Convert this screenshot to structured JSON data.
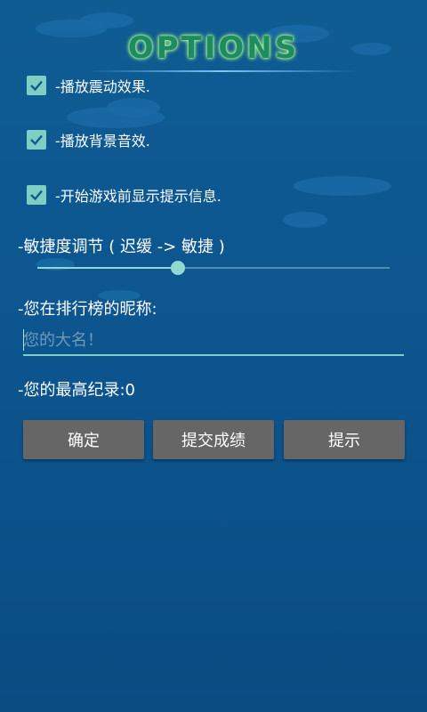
{
  "header": {
    "title": "OPTIONS"
  },
  "checkboxes": [
    {
      "label": "-播放震动效果.",
      "checked": true
    },
    {
      "label": "-播放背景音效.",
      "checked": true
    },
    {
      "label": "-开始游戏前显示提示信息.",
      "checked": true
    }
  ],
  "sensitivity": {
    "label": "-敏捷度调节 ( 迟缓 -> 敏捷 )",
    "value_fraction": 0.4
  },
  "nickname": {
    "label": "-您在排行榜的昵称:",
    "placeholder": "您的大名！",
    "value": ""
  },
  "high_score": {
    "label": "-您的最高纪录:0"
  },
  "buttons": {
    "confirm": "确定",
    "submit_score": "提交成绩",
    "hint": "提示"
  },
  "colors": {
    "accent": "#7dcfc4",
    "button": "#666666",
    "background": "#0d5690"
  }
}
